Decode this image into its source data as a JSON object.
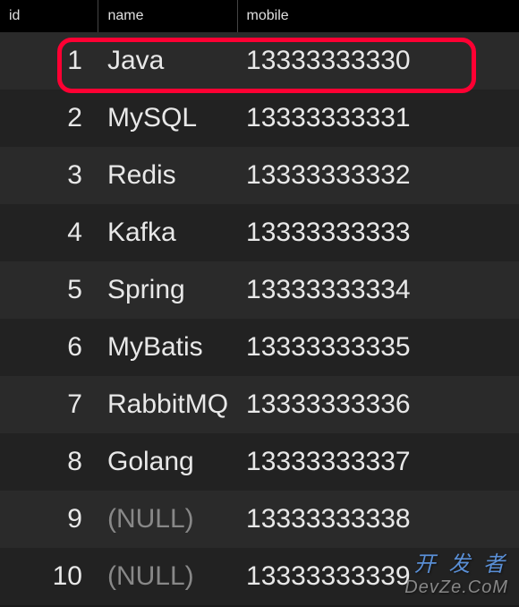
{
  "columns": {
    "id": "id",
    "name": "name",
    "mobile": "mobile"
  },
  "rows": [
    {
      "id": "1",
      "name": "Java",
      "mobile": "13333333330",
      "null_name": false,
      "highlighted": true
    },
    {
      "id": "2",
      "name": "MySQL",
      "mobile": "13333333331",
      "null_name": false,
      "highlighted": false
    },
    {
      "id": "3",
      "name": "Redis",
      "mobile": "13333333332",
      "null_name": false,
      "highlighted": false
    },
    {
      "id": "4",
      "name": "Kafka",
      "mobile": "13333333333",
      "null_name": false,
      "highlighted": false
    },
    {
      "id": "5",
      "name": "Spring",
      "mobile": "13333333334",
      "null_name": false,
      "highlighted": false
    },
    {
      "id": "6",
      "name": "MyBatis",
      "mobile": "13333333335",
      "null_name": false,
      "highlighted": false
    },
    {
      "id": "7",
      "name": "RabbitMQ",
      "mobile": "13333333336",
      "null_name": false,
      "highlighted": false
    },
    {
      "id": "8",
      "name": "Golang",
      "mobile": "13333333337",
      "null_name": false,
      "highlighted": false
    },
    {
      "id": "9",
      "name": "(NULL)",
      "mobile": "13333333338",
      "null_name": true,
      "highlighted": false
    },
    {
      "id": "10",
      "name": "(NULL)",
      "mobile": "13333333339",
      "null_name": true,
      "highlighted": false
    }
  ],
  "watermark": {
    "line1": "开 发 者",
    "line2": "DevZe.CoM"
  }
}
